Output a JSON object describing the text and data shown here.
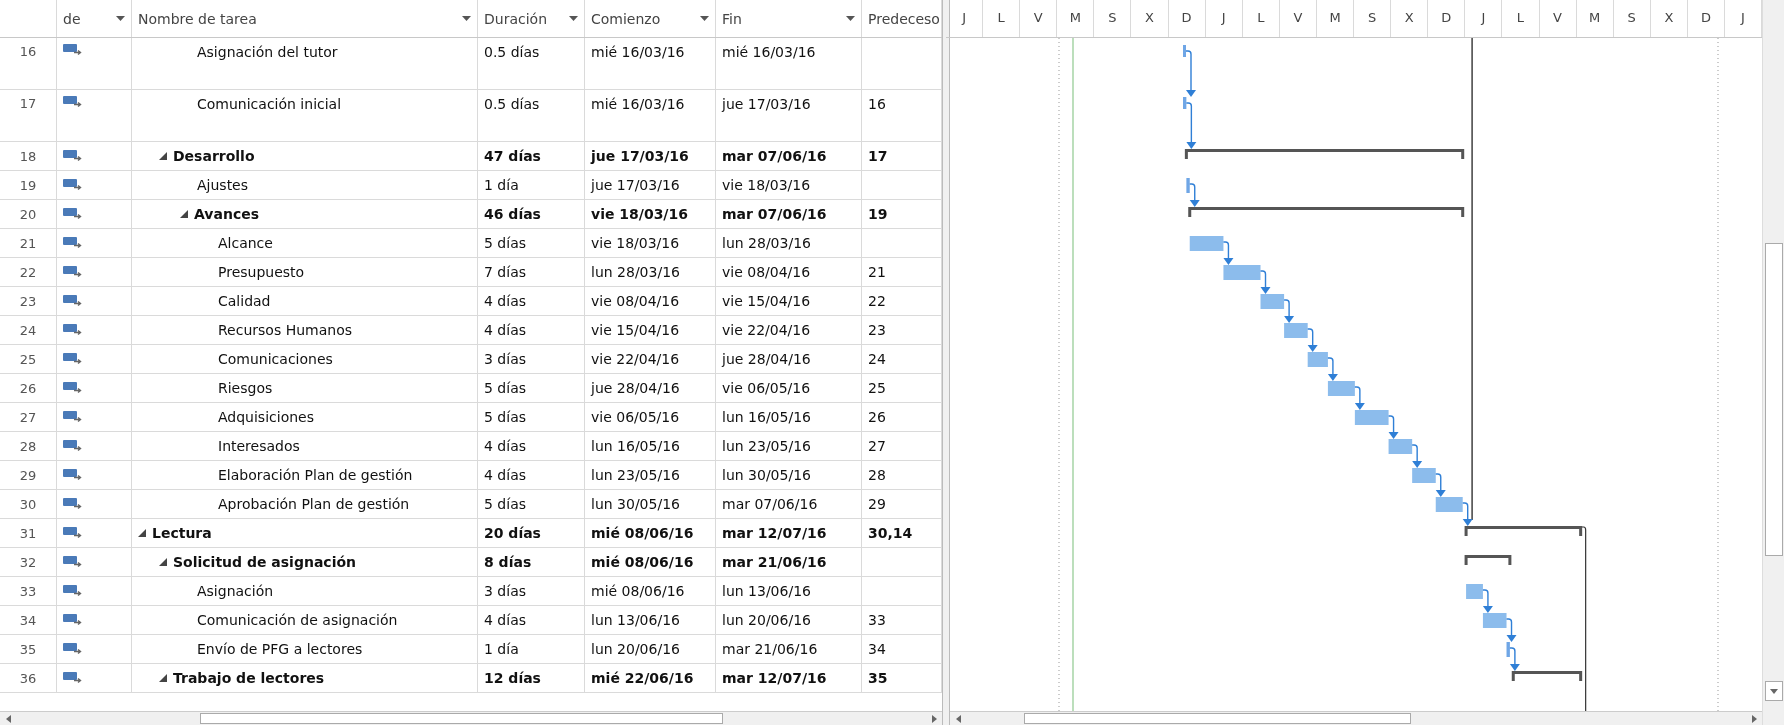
{
  "table": {
    "columns": [
      {
        "label": "de",
        "menu": true
      },
      {
        "label": "Nombre de tarea",
        "menu": true
      },
      {
        "label": "Duración",
        "menu": true
      },
      {
        "label": "Comienzo",
        "menu": true
      },
      {
        "label": "Fin",
        "menu": true
      },
      {
        "label": "Predeceso",
        "menu": false
      }
    ],
    "tasks": [
      {
        "children": [
          {
            "children": [
              {
                "id": "16",
                "kind": "task",
                "name": "Asignación del tutor",
                "duration": "0.5 días",
                "start": "mié 16/03/16",
                "finish": "mié 16/03/16"
              },
              {
                "id": "17",
                "kind": "task",
                "name": "Comunicación inicial",
                "duration": "0.5 días",
                "start": "mié 16/03/16",
                "finish": "jue 17/03/16",
                "predecessors": "16"
              }
            ]
          },
          {
            "id": "18",
            "kind": "summary",
            "expanded": true,
            "name": "Desarrollo",
            "duration": "47 días",
            "start": "jue 17/03/16",
            "finish": "mar 07/06/16",
            "predecessors": "17",
            "children": [
              {
                "id": "19",
                "kind": "task",
                "name": "Ajustes",
                "duration": "1 día",
                "start": "jue 17/03/16",
                "finish": "vie 18/03/16"
              },
              {
                "id": "20",
                "kind": "summary",
                "expanded": true,
                "name": "Avances",
                "duration": "46 días",
                "start": "vie 18/03/16",
                "finish": "mar 07/06/16",
                "predecessors": "19",
                "children": [
                  {
                    "id": "21",
                    "kind": "task",
                    "name": "Alcance",
                    "duration": "5 días",
                    "start": "vie 18/03/16",
                    "finish": "lun 28/03/16"
                  },
                  {
                    "id": "22",
                    "kind": "task",
                    "name": "Presupuesto",
                    "duration": "7 días",
                    "start": "lun 28/03/16",
                    "finish": "vie 08/04/16",
                    "predecessors": "21"
                  },
                  {
                    "id": "23",
                    "kind": "task",
                    "name": "Calidad",
                    "duration": "4 días",
                    "start": "vie 08/04/16",
                    "finish": "vie 15/04/16",
                    "predecessors": "22"
                  },
                  {
                    "id": "24",
                    "kind": "task",
                    "name": "Recursos Humanos",
                    "duration": "4 días",
                    "start": "vie 15/04/16",
                    "finish": "vie 22/04/16",
                    "predecessors": "23"
                  },
                  {
                    "id": "25",
                    "kind": "task",
                    "name": "Comunicaciones",
                    "duration": "3 días",
                    "start": "vie 22/04/16",
                    "finish": "jue 28/04/16",
                    "predecessors": "24"
                  },
                  {
                    "id": "26",
                    "kind": "task",
                    "name": "Riesgos",
                    "duration": "5 días",
                    "start": "jue 28/04/16",
                    "finish": "vie 06/05/16",
                    "predecessors": "25"
                  },
                  {
                    "id": "27",
                    "kind": "task",
                    "name": "Adquisiciones",
                    "duration": "5 días",
                    "start": "vie 06/05/16",
                    "finish": "lun 16/05/16",
                    "predecessors": "26"
                  },
                  {
                    "id": "28",
                    "kind": "task",
                    "name": "Interesados",
                    "duration": "4 días",
                    "start": "lun 16/05/16",
                    "finish": "lun 23/05/16",
                    "predecessors": "27"
                  },
                  {
                    "id": "29",
                    "kind": "task",
                    "name": "Elaboración Plan de gestión",
                    "duration": "4 días",
                    "start": "lun 23/05/16",
                    "finish": "lun 30/05/16",
                    "predecessors": "28"
                  },
                  {
                    "id": "30",
                    "kind": "task",
                    "name": "Aprobación Plan de gestión",
                    "duration": "5 días",
                    "start": "lun 30/05/16",
                    "finish": "mar 07/06/16",
                    "predecessors": "29"
                  }
                ]
              }
            ]
          }
        ]
      },
      {
        "id": "31",
        "kind": "summary",
        "expanded": true,
        "name": "Lectura",
        "duration": "20 días",
        "start": "mié 08/06/16",
        "finish": "mar 12/07/16",
        "predecessors": "30,14",
        "children": [
          {
            "id": "32",
            "kind": "summary",
            "expanded": true,
            "name": "Solicitud de asignación",
            "duration": "8 días",
            "start": "mié 08/06/16",
            "finish": "mar 21/06/16",
            "children": [
              {
                "id": "33",
                "kind": "task",
                "name": "Asignación",
                "duration": "3 días",
                "start": "mié 08/06/16",
                "finish": "lun 13/06/16"
              },
              {
                "id": "34",
                "kind": "task",
                "name": "Comunicación de asignación",
                "duration": "4 días",
                "start": "lun 13/06/16",
                "finish": "lun 20/06/16",
                "predecessors": "33"
              },
              {
                "id": "35",
                "kind": "task",
                "name": "Envío de PFG a lectores",
                "duration": "1 día",
                "start": "lun 20/06/16",
                "finish": "mar 21/06/16",
                "predecessors": "34"
              }
            ]
          },
          {
            "id": "36",
            "kind": "summary",
            "expanded": true,
            "name": "Trabajo de lectores",
            "duration": "12 días",
            "start": "mié 22/06/16",
            "finish": "mar 12/07/16",
            "predecessors": "35"
          }
        ]
      }
    ]
  },
  "timescale": {
    "days": [
      "J",
      "L",
      "V",
      "M",
      "S",
      "X",
      "D",
      "J",
      "L",
      "V",
      "M",
      "S",
      "X",
      "D",
      "J",
      "L",
      "V",
      "M",
      "S",
      "X",
      "D",
      "J"
    ]
  }
}
